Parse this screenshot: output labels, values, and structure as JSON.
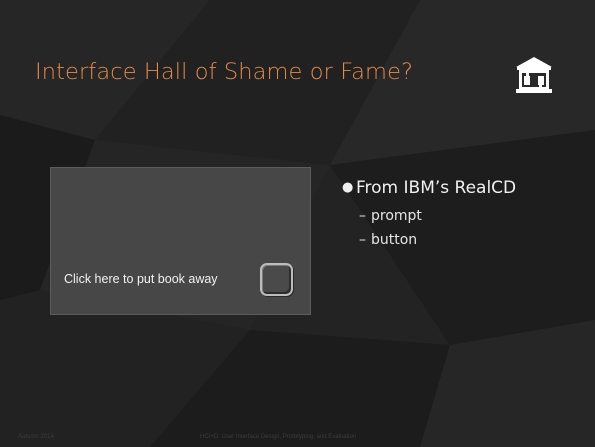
{
  "slide": {
    "title": "Interface Hall of Shame or Fame?",
    "logo_icon": "hall-of-fame-building-icon",
    "example_screenshot": {
      "prompt_text": "Click here to put book away"
    },
    "bullets": {
      "main": "From IBM’s RealCD",
      "subs": [
        "prompt",
        "button"
      ]
    },
    "footer": {
      "left": "Autumn 2014",
      "center": "HCI+D: User Interface Design, Prototyping, and Evaluation"
    }
  },
  "colors": {
    "background": "#1e1e1e",
    "title": "#e58a4c",
    "text": "#f0f0f0"
  }
}
